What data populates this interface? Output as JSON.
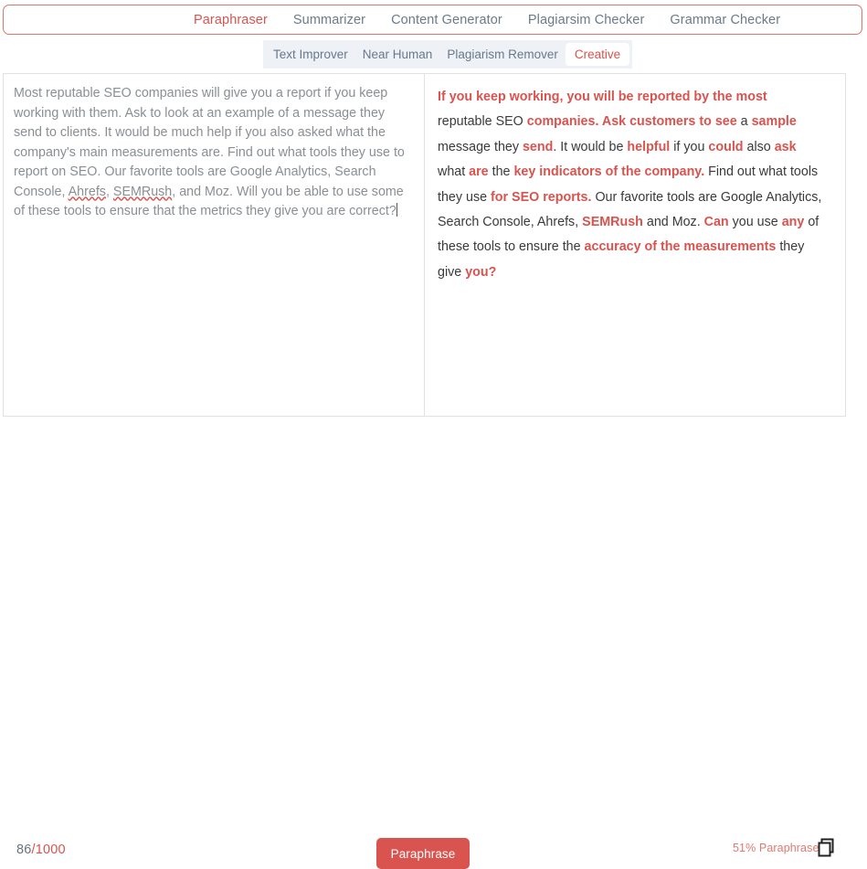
{
  "colors": {
    "accent_red": "#d9534f",
    "muted_text": "#8a8f94",
    "tab_text": "#6c7a89",
    "subbar_bg": "#eef1f6",
    "panel_border": "#e2e2e2"
  },
  "top_tabs": [
    {
      "label": "Paraphraser",
      "active": true
    },
    {
      "label": "Summarizer",
      "active": false
    },
    {
      "label": "Content Generator",
      "active": false
    },
    {
      "label": "Plagiarsim Checker",
      "active": false
    },
    {
      "label": "Grammar Checker",
      "active": false
    }
  ],
  "sub_tabs": [
    {
      "label": "Text Improver",
      "active": false
    },
    {
      "label": "Near Human",
      "active": false
    },
    {
      "label": "Plagiarism Remover",
      "active": false
    },
    {
      "label": "Creative",
      "active": true
    }
  ],
  "input_pane": {
    "text": "Most reputable SEO companies will give you a report if you keep working with them. Ask to look at an example of a message they send to clients. It would be much help if you also asked what the company's main measurements are. Find out what tools they use to report on SEO. Our favorite tools are Google Analytics, Search Console, Ahrefs, SEMRush, and Moz. Will you be able to use some of these tools to ensure that the metrics they give you are correct?",
    "segments": [
      {
        "t": "Most reputable SEO companies will give you a report if you keep working with them. Ask to look at an example of a message they send to clients. It would be much help if you also asked what the company's main measurements are. Find out what tools they use to report on SEO. Our favorite tools are Google Analytics, Search Console, ",
        "misspelled": false
      },
      {
        "t": "Ahrefs",
        "misspelled": true
      },
      {
        "t": ", ",
        "misspelled": false
      },
      {
        "t": "SEMRush",
        "misspelled": true
      },
      {
        "t": ", and Moz. Will you be able to use some of these tools to ensure that the metrics they give you are correct?",
        "misspelled": false
      }
    ]
  },
  "output_pane": {
    "text": "If you keep working, you will be reported by the most reputable SEO companies. Ask customers to see a sample message they send. It would be helpful if you could also ask what are the key indicators of the company. Find out what tools they use for SEO reports. Our favorite tools are Google Analytics, Search Console, Ahrefs, SEMRush and Moz. Can you use any of these tools to ensure the accuracy of the measurements they give you?",
    "segments": [
      {
        "t": "If you keep working, you will be reported by the most ",
        "hl": true
      },
      {
        "t": "reputable SEO ",
        "hl": false
      },
      {
        "t": "companies. Ask customers to see ",
        "hl": true
      },
      {
        "t": "a ",
        "hl": false
      },
      {
        "t": "sample ",
        "hl": true
      },
      {
        "t": "message they ",
        "hl": false
      },
      {
        "t": "send",
        "hl": true
      },
      {
        "t": ". It would be ",
        "hl": false
      },
      {
        "t": "helpful ",
        "hl": true
      },
      {
        "t": "if you ",
        "hl": false
      },
      {
        "t": "could ",
        "hl": true
      },
      {
        "t": "also ",
        "hl": false
      },
      {
        "t": "ask ",
        "hl": true
      },
      {
        "t": "what ",
        "hl": false
      },
      {
        "t": "are ",
        "hl": true
      },
      {
        "t": "the ",
        "hl": false
      },
      {
        "t": "key indicators of the company.",
        "hl": true
      },
      {
        "t": " Find out what tools they use ",
        "hl": false
      },
      {
        "t": "for SEO reports.",
        "hl": true
      },
      {
        "t": " Our favorite tools are Google Analytics, Search Console, Ahrefs, ",
        "hl": false
      },
      {
        "t": "SEMRush",
        "hl": true
      },
      {
        "t": " and Moz. ",
        "hl": false
      },
      {
        "t": "Can",
        "hl": true
      },
      {
        "t": " you use ",
        "hl": false
      },
      {
        "t": "any",
        "hl": true
      },
      {
        "t": " of these tools to ensure the ",
        "hl": false
      },
      {
        "t": "accuracy of the measurements",
        "hl": true
      },
      {
        "t": " they give ",
        "hl": false
      },
      {
        "t": "you?",
        "hl": true
      }
    ]
  },
  "footer": {
    "char_count": "86",
    "char_limit": "/1000",
    "paraphrase_button": "Paraphrase",
    "paraphrased_label": "51% Paraphrased",
    "copy_icon": "copy-icon"
  }
}
